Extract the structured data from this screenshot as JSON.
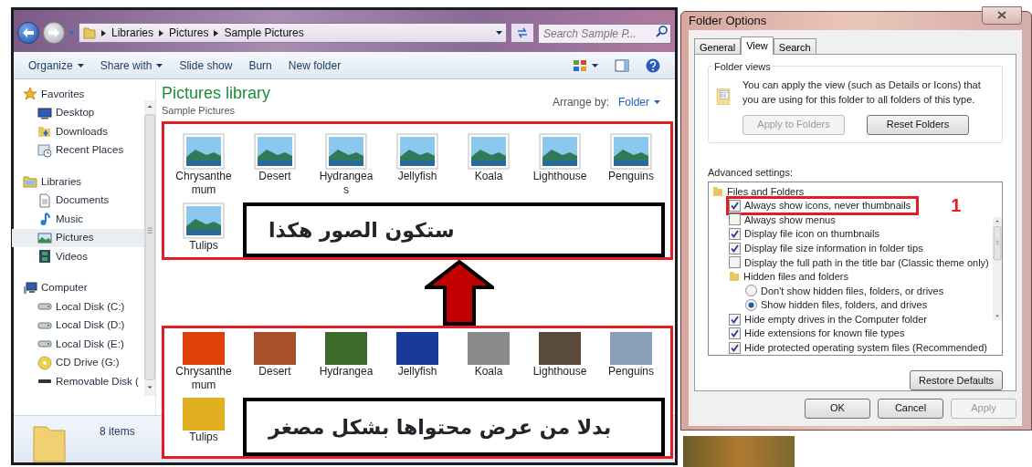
{
  "explorer": {
    "breadcrumbs": [
      "Libraries",
      "Pictures",
      "Sample Pictures"
    ],
    "search": {
      "placeholder": "Search Sample P..."
    },
    "toolbar": [
      {
        "label": "Organize",
        "dropdown": true
      },
      {
        "label": "Share with",
        "dropdown": true
      },
      {
        "label": "Slide show",
        "dropdown": false
      },
      {
        "label": "Burn",
        "dropdown": false
      },
      {
        "label": "New folder",
        "dropdown": false
      }
    ],
    "sidebar": [
      {
        "kind": "favorites",
        "label": "Favorites",
        "children": [
          {
            "kind": "desktop",
            "label": "Desktop",
            "selected": false
          },
          {
            "kind": "downloads",
            "label": "Downloads",
            "selected": false
          },
          {
            "kind": "recent",
            "label": "Recent Places",
            "selected": false
          }
        ]
      },
      {
        "kind": "libraries",
        "label": "Libraries",
        "children": [
          {
            "kind": "documents",
            "label": "Documents",
            "selected": false
          },
          {
            "kind": "music",
            "label": "Music",
            "selected": false
          },
          {
            "kind": "pictures",
            "label": "Pictures",
            "selected": true
          },
          {
            "kind": "videos",
            "label": "Videos",
            "selected": false
          }
        ]
      },
      {
        "kind": "computer",
        "label": "Computer",
        "children": [
          {
            "kind": "disk",
            "label": "Local Disk (C:)",
            "selected": false
          },
          {
            "kind": "disk",
            "label": "Local Disk (D:)",
            "selected": false
          },
          {
            "kind": "disk",
            "label": "Local Disk (E:)",
            "selected": false
          },
          {
            "kind": "cd",
            "label": "CD Drive (G:)",
            "selected": false
          },
          {
            "kind": "removable",
            "label": "Removable Disk (",
            "selected": false
          }
        ]
      }
    ],
    "library": {
      "title": "Pictures library",
      "subtitle": "Sample Pictures",
      "arrange_label": "Arrange by:",
      "arrange_value": "Folder"
    },
    "icon_view": {
      "items": [
        {
          "label": "Chrysanthemum"
        },
        {
          "label": "Desert"
        },
        {
          "label": "Hydrangeas"
        },
        {
          "label": "Jellyfish"
        },
        {
          "label": "Koala"
        },
        {
          "label": "Lighthouse"
        },
        {
          "label": "Penguins"
        },
        {
          "label": "Tulips"
        }
      ],
      "note": "ستكون الصور هكذا"
    },
    "thumbnail_view": {
      "items": [
        {
          "label": "Chrysanthemum",
          "color": "#e0400a"
        },
        {
          "label": "Desert",
          "color": "#a8502a"
        },
        {
          "label": "Hydrangea",
          "color": "#3c6a2a"
        },
        {
          "label": "Jellyfish",
          "color": "#1a3a9a"
        },
        {
          "label": "Koala",
          "color": "#8a8a88"
        },
        {
          "label": "Lighthouse",
          "color": "#5a4a3a"
        },
        {
          "label": "Penguins",
          "color": "#8aa0b8"
        },
        {
          "label": "Tulips",
          "color": "#e0b020"
        }
      ],
      "note": "بدلا من عرض محتواها بشكل مصغر"
    },
    "status_bar": {
      "count": "8 items"
    }
  },
  "folder_options": {
    "title": "Folder Options",
    "tabs": [
      {
        "label": "General",
        "selected": false
      },
      {
        "label": "View",
        "selected": true
      },
      {
        "label": "Search",
        "selected": false
      }
    ],
    "folder_views": {
      "legend": "Folder views",
      "description": "You can apply the view (such as Details or Icons) that you are using for this folder to all folders of this type.",
      "buttons": [
        {
          "label": "Apply to Folders",
          "disabled": true
        },
        {
          "label": "Reset Folders",
          "disabled": false
        }
      ]
    },
    "advanced_settings": {
      "label": "Advanced settings:",
      "marker": "1",
      "items": [
        {
          "kind": "folder",
          "label": "Files and Folders",
          "children": [
            {
              "kind": "checkbox",
              "label": "Always show icons, never thumbnails",
              "checked": true,
              "highlighted": true
            },
            {
              "kind": "checkbox",
              "label": "Always show menus",
              "checked": false,
              "highlighted": false
            },
            {
              "kind": "checkbox",
              "label": "Display file icon on thumbnails",
              "checked": true,
              "highlighted": false
            },
            {
              "kind": "checkbox",
              "label": "Display file size information in folder tips",
              "checked": true,
              "highlighted": false
            },
            {
              "kind": "checkbox",
              "label": "Display the full path in the title bar (Classic theme only)",
              "checked": false,
              "highlighted": false
            },
            {
              "kind": "folder",
              "label": "Hidden files and folders",
              "children": [
                {
                  "kind": "radio",
                  "label": "Don't show hidden files, folders, or drives",
                  "selected": false
                },
                {
                  "kind": "radio",
                  "label": "Show hidden files, folders, and drives",
                  "selected": true
                }
              ]
            },
            {
              "kind": "checkbox",
              "label": "Hide empty drives in the Computer folder",
              "checked": true,
              "highlighted": false
            },
            {
              "kind": "checkbox",
              "label": "Hide extensions for known file types",
              "checked": true,
              "highlighted": false
            },
            {
              "kind": "checkbox",
              "label": "Hide protected operating system files (Recommended)",
              "checked": true,
              "highlighted": false
            }
          ]
        }
      ]
    },
    "restore_button": "Restore Defaults",
    "buttons": [
      {
        "label": "OK",
        "disabled": false
      },
      {
        "label": "Cancel",
        "disabled": false
      },
      {
        "label": "Apply",
        "disabled": true
      }
    ]
  }
}
